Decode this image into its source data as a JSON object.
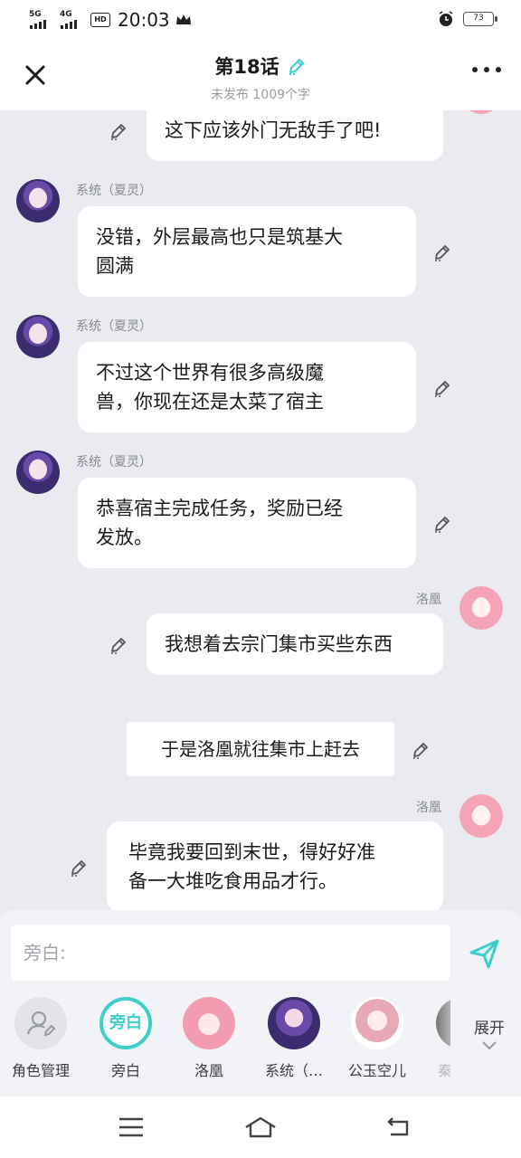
{
  "status_bar": {
    "net1": "5G",
    "net2": "4G",
    "hd": "HD",
    "time": "20:03",
    "battery": "73"
  },
  "header": {
    "title": "第18话",
    "subtitle": "未发布 1009个字"
  },
  "messages": [
    {
      "speaker": "",
      "text": "这下应该外门无敌手了吧!",
      "side": "right"
    },
    {
      "speaker": "系统（夏灵）",
      "lines": [
        "没错，外层最高也只是筑基大",
        "圆满"
      ],
      "side": "left"
    },
    {
      "speaker": "系统（夏灵）",
      "lines": [
        "不过这个世界有很多高级魔",
        "兽，你现在还是太菜了宿主"
      ],
      "side": "left"
    },
    {
      "speaker": "系统（夏灵）",
      "lines": [
        "恭喜宿主完成任务，奖励已经",
        "发放。"
      ],
      "side": "left"
    },
    {
      "speaker": "洛凰",
      "text": "我想着去宗门集市买些东西",
      "side": "right"
    },
    {
      "narration": "于是洛凰就往集市上赶去"
    },
    {
      "speaker": "洛凰",
      "lines": [
        "毕竟我要回到末世，得好好准",
        "备一大堆吃食用品才行。"
      ],
      "side": "right"
    }
  ],
  "composer": {
    "placeholder": "旁白:"
  },
  "roles": [
    {
      "label": "角色管理"
    },
    {
      "label": "旁白",
      "avatar_text": "旁白"
    },
    {
      "label": "洛凰"
    },
    {
      "label": "系统（…"
    },
    {
      "label": "公玉空儿"
    },
    {
      "label": "秦"
    }
  ],
  "expand_label": "展开",
  "colors": {
    "accent": "#3ed0c8",
    "background": "#e9ebf0",
    "bubble": "#ffffff"
  },
  "icons": {
    "close": "close-icon",
    "more": "more-icon",
    "edit": "pencil-icon",
    "send": "send-icon",
    "expand": "chevron-down-icon"
  }
}
